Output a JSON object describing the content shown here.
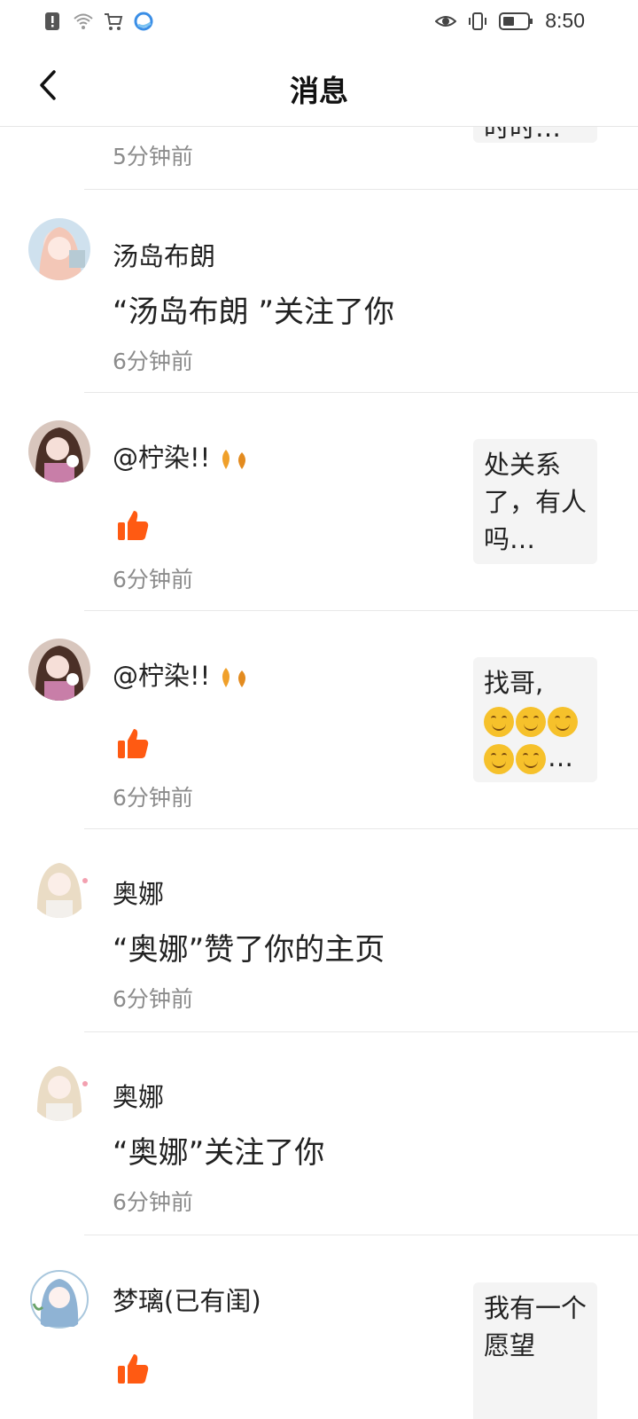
{
  "status_bar": {
    "time": "8:50"
  },
  "header": {
    "title": "消息",
    "back_icon": "chevron-left-icon"
  },
  "notifications": [
    {
      "time": "5分钟前",
      "preview": "时时…"
    },
    {
      "username": "汤岛布朗",
      "content": "“汤岛布朗 ”关注了你",
      "time": "6分钟前"
    },
    {
      "username": "@柠染!!",
      "like": true,
      "time": "6分钟前",
      "preview": "处关系了，有人吗…"
    },
    {
      "username": "@柠染!!",
      "like": true,
      "time": "6分钟前",
      "preview": "找哥,",
      "preview_tail": "…"
    },
    {
      "username": "奥娜",
      "content": "“奥娜”赞了你的主页",
      "time": "6分钟前"
    },
    {
      "username": "奥娜",
      "content": "“奥娜”关注了你",
      "time": "6分钟前"
    },
    {
      "username": "梦璃(已有闺)",
      "like": true,
      "preview": "我有一个愿望"
    }
  ],
  "colors": {
    "like": "#ff5a12",
    "divider": "#e8e8e8",
    "time_text": "#8c8c8c",
    "preview_bg": "#f4f4f4"
  }
}
